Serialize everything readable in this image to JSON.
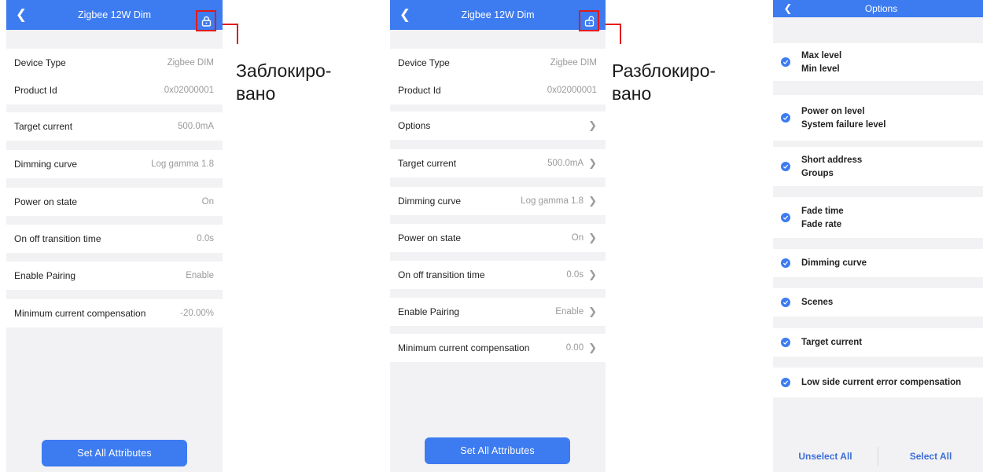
{
  "locked_screen": {
    "header": {
      "title": "Zigbee 12W Dim"
    },
    "rows": [
      {
        "label": "Device Type",
        "value": "Zigbee DIM"
      },
      {
        "label": "Product Id",
        "value": "0x02000001"
      },
      {
        "label": "Target current",
        "value": "500.0mA"
      },
      {
        "label": "Dimming curve",
        "value": "Log gamma 1.8"
      },
      {
        "label": "Power on state",
        "value": "On"
      },
      {
        "label": "On off transition time",
        "value": "0.0s"
      },
      {
        "label": "Enable Pairing",
        "value": "Enable"
      },
      {
        "label": "Minimum current compensation",
        "value": "-20.00%"
      }
    ],
    "set_all_label": "Set All Attributes",
    "annotation": {
      "line1": "Заблокиро-",
      "line2": "вано"
    }
  },
  "unlocked_screen": {
    "header": {
      "title": "Zigbee 12W Dim"
    },
    "rows": [
      {
        "label": "Device Type",
        "value": "Zigbee DIM"
      },
      {
        "label": "Product Id",
        "value": "0x02000001"
      },
      {
        "label": "Options",
        "value": ""
      },
      {
        "label": "Target current",
        "value": "500.0mA"
      },
      {
        "label": "Dimming curve",
        "value": "Log gamma 1.8"
      },
      {
        "label": "Power on state",
        "value": "On"
      },
      {
        "label": "On off transition time",
        "value": "0.0s"
      },
      {
        "label": "Enable Pairing",
        "value": "Enable"
      },
      {
        "label": "Minimum current compensation",
        "value": "0.00"
      }
    ],
    "set_all_label": "Set All Attributes",
    "annotation": {
      "line1": "Разблокиро-",
      "line2": "вано"
    }
  },
  "options_screen": {
    "header": {
      "title": "Options"
    },
    "items": [
      {
        "line1": "Max level",
        "line2": "Min level"
      },
      {
        "line1": "Power on level",
        "line2": "System failure level"
      },
      {
        "line1": "Short address",
        "line2": "Groups"
      },
      {
        "line1": "Fade time",
        "line2": "Fade rate"
      },
      {
        "line1": "Dimming curve",
        "line2": ""
      },
      {
        "line1": "Scenes",
        "line2": ""
      },
      {
        "line1": "Target current",
        "line2": ""
      },
      {
        "line1": "Low side current error compensation",
        "line2": ""
      }
    ],
    "footer": {
      "unselect_label": "Unselect All",
      "select_label": "Select All"
    }
  },
  "icons": {
    "back": "chevron-left-icon",
    "locked": "lock-closed-icon",
    "unlocked": "lock-open-icon",
    "chevron": "chevron-right-icon",
    "check": "check-circle-icon"
  },
  "colors": {
    "accent": "#3d7bf0",
    "highlight": "#e21b1b",
    "background": "#f2f2f4",
    "value_text": "#9a9a9a",
    "footer_text": "#3d6fd6"
  }
}
